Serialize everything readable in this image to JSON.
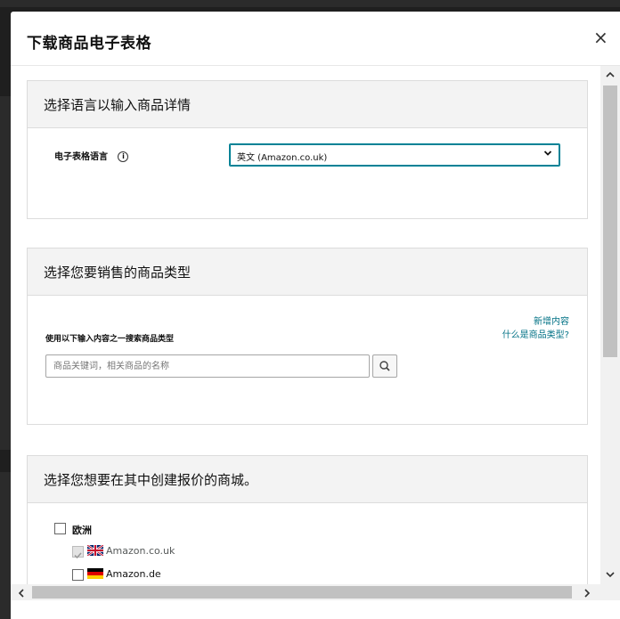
{
  "modal": {
    "title": "下载商品电子表格",
    "close": "×"
  },
  "language_section": {
    "heading": "选择语言以输入商品详情",
    "field_label": "电子表格语言",
    "info_icon": "ⓘ",
    "selected_value": "英文 (Amazon.co.uk)"
  },
  "product_type_section": {
    "heading": "选择您要销售的商品类型",
    "search_label": "使用以下输入内容之一搜索商品类型",
    "link_new": "新增内容",
    "link_what": "什么是商品类型?",
    "search_placeholder": "商品关键词，相关商品的名称"
  },
  "marketplace_section": {
    "heading": "选择您想要在其中创建报价的商城。",
    "region_label": "欧洲",
    "marketplaces": [
      {
        "label": "Amazon.co.uk",
        "flag": "uk-flag",
        "state": "checked-disabled"
      },
      {
        "label": "Amazon.de",
        "flag": "de-flag",
        "state": "unchecked"
      },
      {
        "label": "",
        "flag": "fr-flag",
        "state": "checked"
      }
    ]
  },
  "colors": {
    "accent": "#008296",
    "link": "#007185",
    "section_head_bg": "#f3f3f3"
  }
}
